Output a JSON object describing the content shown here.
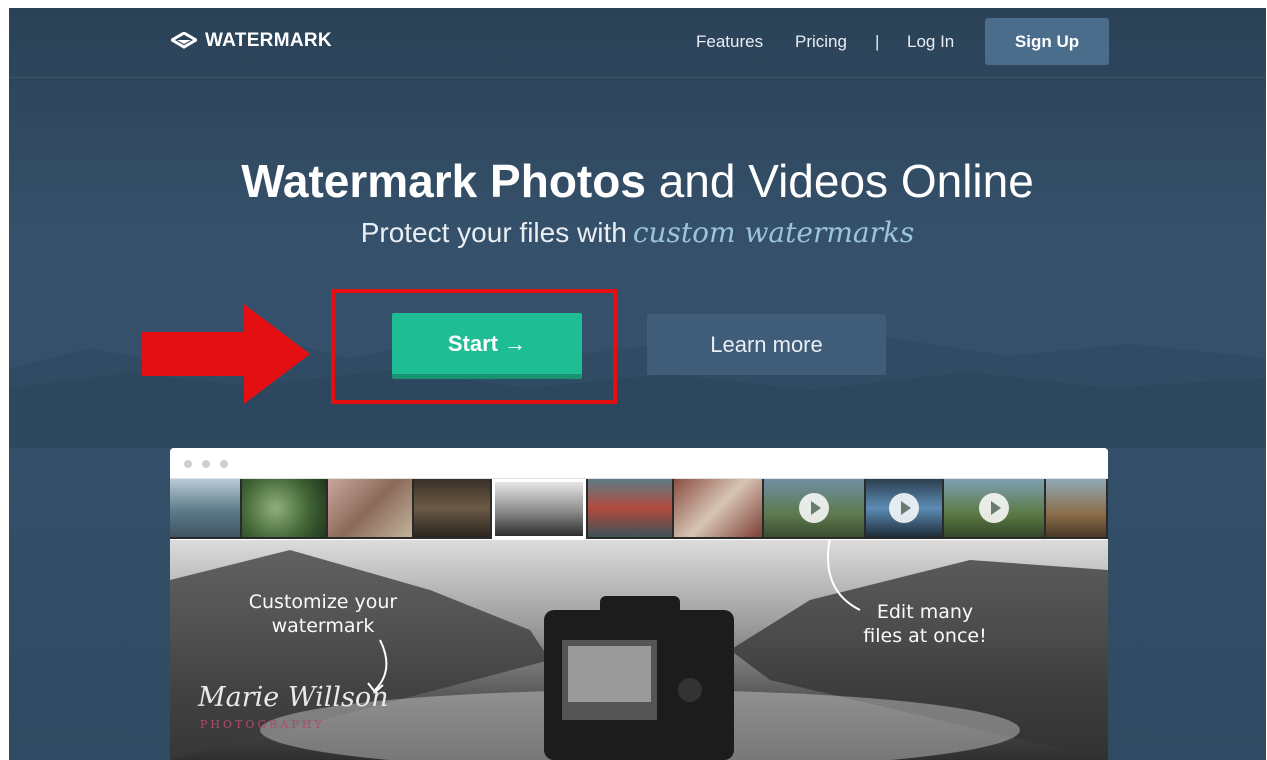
{
  "nav": {
    "logo_text": "WATERMARK",
    "links": [
      "Features",
      "Pricing"
    ],
    "separator": "|",
    "login": "Log In",
    "signup": "Sign Up"
  },
  "hero": {
    "title_bold": "Watermark Photos",
    "title_rest": "and Videos Online",
    "subtitle": "Protect your files with",
    "subtitle_accent": "custom watermarks",
    "start_label": "Start →",
    "learn_label": "Learn more"
  },
  "preview": {
    "annotation_left_1": "Customize your",
    "annotation_left_2": "watermark",
    "annotation_right_1": "Edit many",
    "annotation_right_2": "files at once!",
    "signature": "Marie Willson",
    "signature_sub": "PHOTOGRAPHY"
  },
  "colors": {
    "accent_green": "#1fbd94",
    "highlight_red": "#e40f12",
    "signup_bg": "#4a6d8c"
  },
  "icons": [
    "watermark-logo-icon",
    "arrow-right-icon",
    "play-icon"
  ]
}
